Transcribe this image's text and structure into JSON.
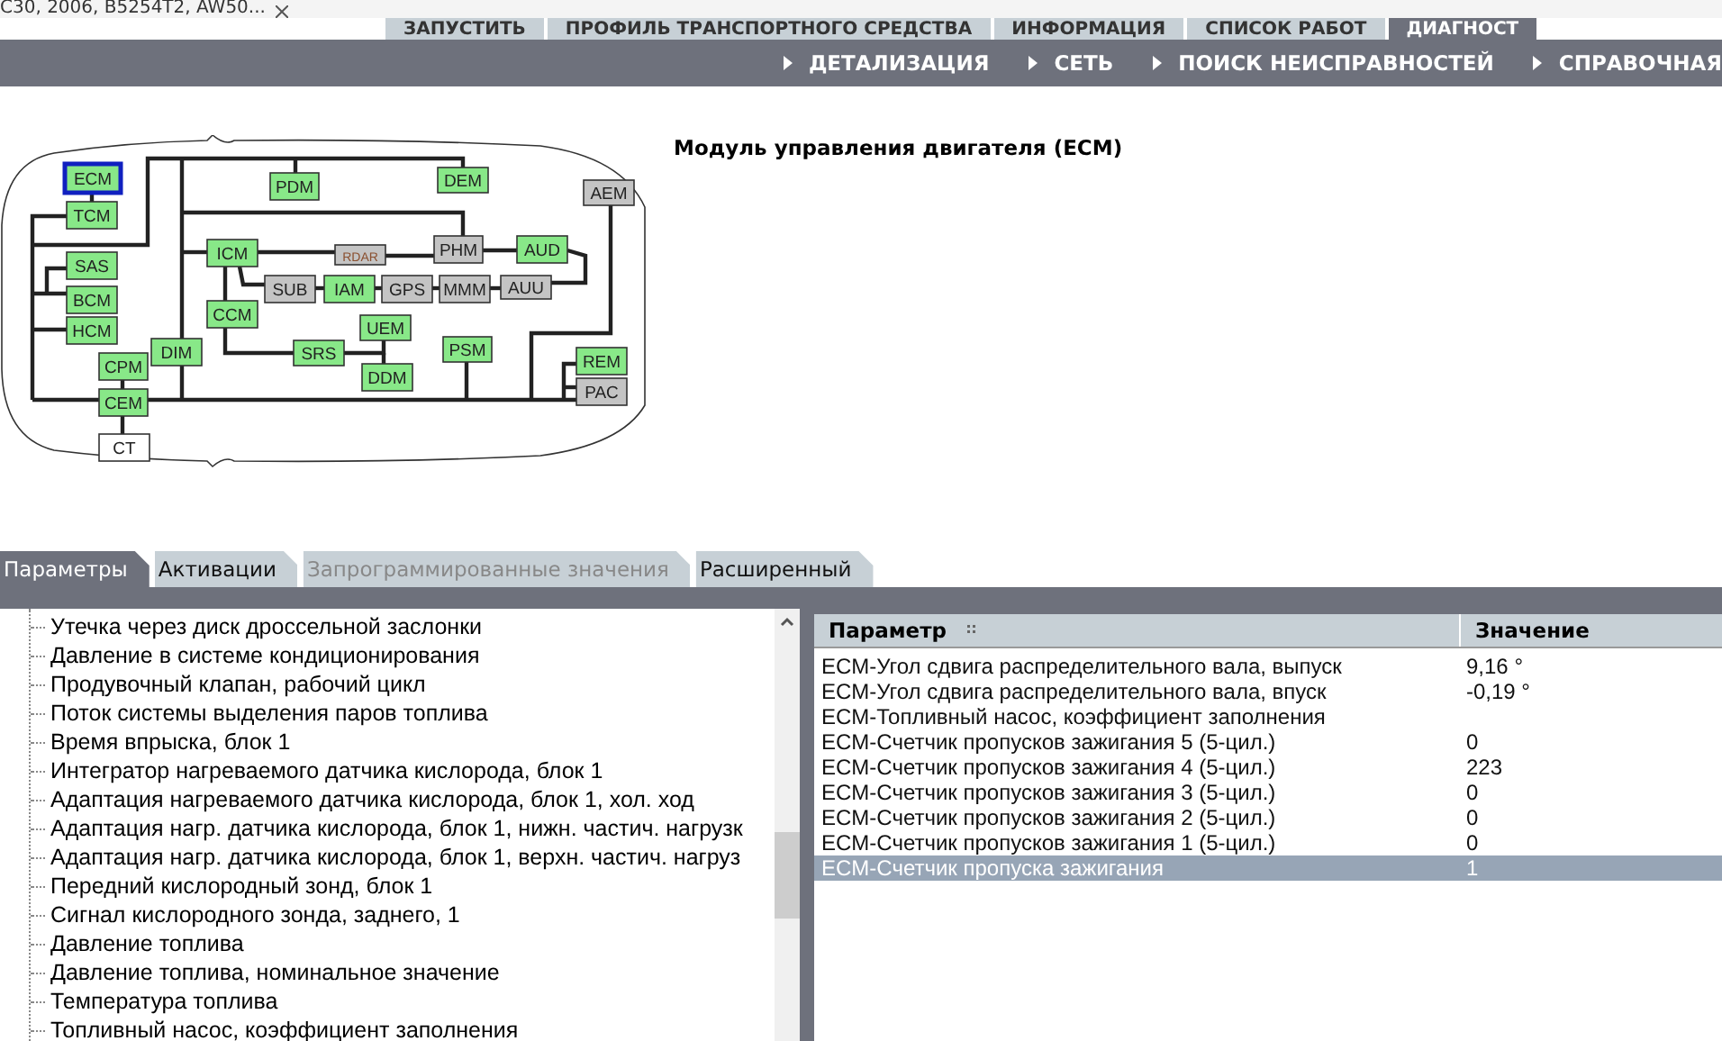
{
  "browser_tab": {
    "title": "C30, 2006, B5254T2, AW50..."
  },
  "top_tabs": [
    {
      "label": "ЗАПУСТИТЬ",
      "selected": false
    },
    {
      "label": "ПРОФИЛЬ ТРАНСПОРТНОГО СРЕДСТВА",
      "selected": false
    },
    {
      "label": "ИНФОРМАЦИЯ",
      "selected": false
    },
    {
      "label": "СПИСОК РАБОТ",
      "selected": false
    },
    {
      "label": "ДИАГНОСТ",
      "selected": true
    }
  ],
  "sub_nav": [
    "ДЕТАЛИЗАЦИЯ",
    "СЕТЬ",
    "ПОИСК НЕИСПРАВНОСТЕЙ",
    "СПРАВОЧНАЯ"
  ],
  "module_title": "Модуль управления двигателя (ECM)",
  "network": {
    "nodes": [
      {
        "label": "ECM",
        "kind": "active",
        "selected": true
      },
      {
        "label": "PDM",
        "kind": "active",
        "selected": false
      },
      {
        "label": "DEM",
        "kind": "active",
        "selected": false
      },
      {
        "label": "AEM",
        "kind": "inactive",
        "selected": false
      },
      {
        "label": "TCM",
        "kind": "active",
        "selected": false
      },
      {
        "label": "ICM",
        "kind": "active",
        "selected": false
      },
      {
        "label": "RDAR",
        "kind": "inactive",
        "selected": false
      },
      {
        "label": "PHM",
        "kind": "inactive",
        "selected": false
      },
      {
        "label": "AUD",
        "kind": "active",
        "selected": false
      },
      {
        "label": "SUB",
        "kind": "inactive",
        "selected": false
      },
      {
        "label": "IAM",
        "kind": "active",
        "selected": false
      },
      {
        "label": "GPS",
        "kind": "inactive",
        "selected": false
      },
      {
        "label": "MMM",
        "kind": "inactive",
        "selected": false
      },
      {
        "label": "AUU",
        "kind": "inactive",
        "selected": false
      },
      {
        "label": "SAS",
        "kind": "active",
        "selected": false
      },
      {
        "label": "BCM",
        "kind": "active",
        "selected": false
      },
      {
        "label": "CCM",
        "kind": "active",
        "selected": false
      },
      {
        "label": "HCM",
        "kind": "active",
        "selected": false
      },
      {
        "label": "UEM",
        "kind": "active",
        "selected": false
      },
      {
        "label": "CPM",
        "kind": "active",
        "selected": false
      },
      {
        "label": "DIM",
        "kind": "active",
        "selected": false
      },
      {
        "label": "SRS",
        "kind": "active",
        "selected": false
      },
      {
        "label": "PSM",
        "kind": "active",
        "selected": false
      },
      {
        "label": "REM",
        "kind": "active",
        "selected": false
      },
      {
        "label": "CEM",
        "kind": "active",
        "selected": false
      },
      {
        "label": "DDM",
        "kind": "active",
        "selected": false
      },
      {
        "label": "PAC",
        "kind": "inactive",
        "selected": false
      },
      {
        "label": "CT",
        "kind": "plain",
        "selected": false
      }
    ]
  },
  "tabs": [
    {
      "label": "Параметры",
      "selected": true,
      "disabled": false
    },
    {
      "label": "Активации",
      "selected": false,
      "disabled": false
    },
    {
      "label": "Запрограммированные значения",
      "selected": false,
      "disabled": true
    },
    {
      "label": "Расширенный",
      "selected": false,
      "disabled": false
    }
  ],
  "parameter_tree": [
    "Утечка через диск дроссельной заслонки",
    "Давление в системе кондиционирования",
    "Продувочный клапан, рабочий цикл",
    "Поток системы выделения паров топлива",
    "Время впрыска, блок 1",
    "Интегратор нагреваемого датчика кислорода, блок 1",
    "Адаптация нагреваемого датчика кислорода, блок 1, хол. ход",
    "Адаптация нагр. датчика кислорода, блок 1, нижн. частич. нагрузк",
    "Адаптация нагр. датчика кислорода, блок 1, верхн. частич. нагруз",
    "Передний кислородный зонд, блок 1",
    "Сигнал кислородного зонда, заднего, 1",
    "Давление топлива",
    "Давление топлива, номинальное значение",
    "Температура топлива",
    "Топливный насос, коэффициент заполнения"
  ],
  "table": {
    "columns": [
      "Параметр",
      "Значение"
    ],
    "rows": [
      {
        "parameter": "ECM-Угол сдвига распределительного вала, выпуск",
        "value": "9,16 °",
        "selected": false
      },
      {
        "parameter": "ECM-Угол сдвига распределительного вала, впуск",
        "value": "-0,19 °",
        "selected": false
      },
      {
        "parameter": "ECM-Топливный насос, коэффициент заполнения",
        "selected": false
      },
      {
        "parameter": "ECM-Счетчик пропусков зажигания 5 (5-цил.)",
        "value": "0",
        "selected": false
      },
      {
        "parameter": "ECM-Счетчик пропусков зажигания 4 (5-цил.)",
        "value": "223",
        "selected": false
      },
      {
        "parameter": "ECM-Счетчик пропусков зажигания 3 (5-цил.)",
        "value": "0",
        "selected": false
      },
      {
        "parameter": "ECM-Счетчик пропусков зажигания 2 (5-цил.)",
        "value": "0",
        "selected": false
      },
      {
        "parameter": "ECM-Счетчик пропусков зажигания 1 (5-цил.)",
        "value": "0",
        "selected": false
      },
      {
        "parameter": "ECM-Счетчик пропуска зажигания",
        "value": "1",
        "selected": true
      }
    ]
  }
}
